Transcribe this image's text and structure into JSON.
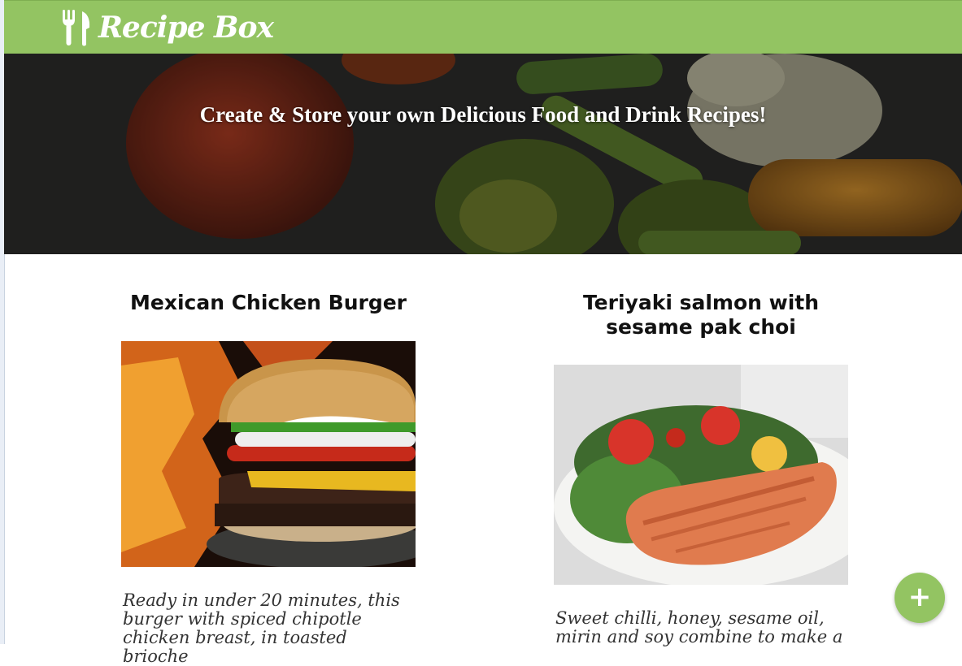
{
  "navbar": {
    "brand": "Recipe Box"
  },
  "hero": {
    "title": "Create & Store your own Delicious Food and Drink Recipes!"
  },
  "recipes": [
    {
      "title": "Mexican Chicken Burger",
      "description_lines": [
        "Ready in under 20 minutes, this",
        "burger with spiced chipotle",
        "chicken breast, in toasted brioche"
      ]
    },
    {
      "title_lines": [
        "Teriyaki salmon with",
        "sesame pak choi"
      ],
      "description_lines": [
        "Sweet chilli, honey, sesame oil,",
        "mirin and soy combine to make a"
      ]
    }
  ],
  "fab": {
    "label": "+"
  },
  "colors": {
    "brand_green": "#93c462"
  }
}
